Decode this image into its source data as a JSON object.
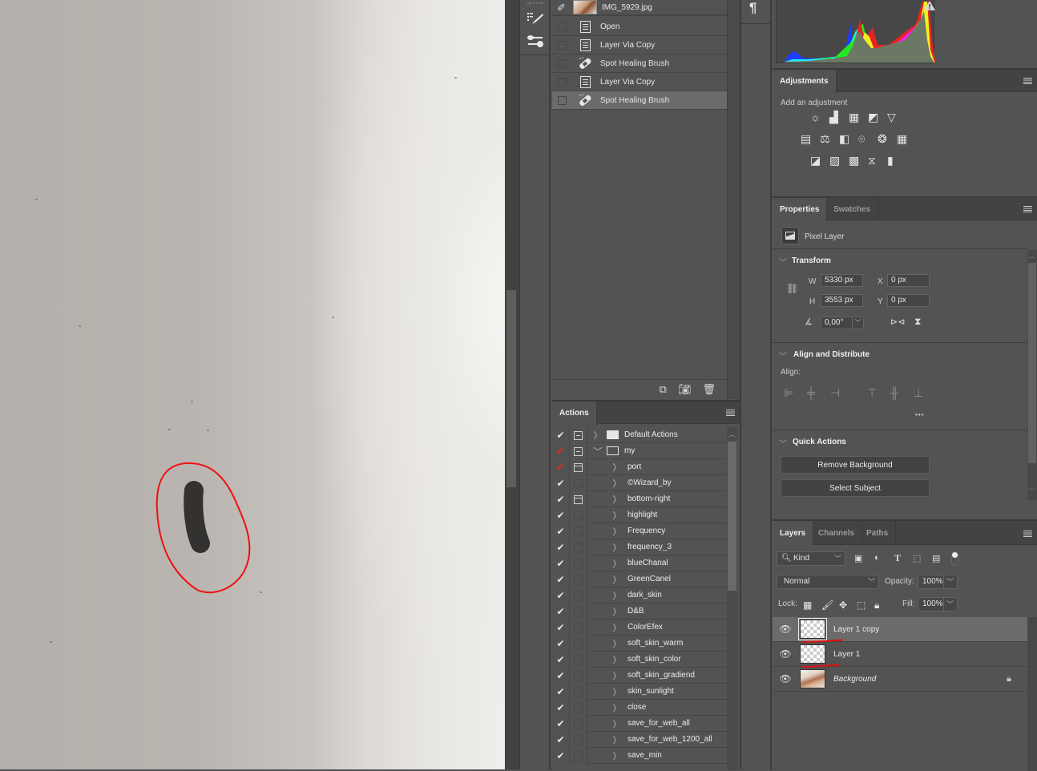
{
  "canvas": {
    "annotation": "red-freehand-circle-around-dark-brush-stroke"
  },
  "toolstrip": {
    "tools": [
      {
        "icon": "brush-presets-icon",
        "label": "Brush presets"
      },
      {
        "icon": "adjust-sliders-icon",
        "label": "Tool presets"
      }
    ]
  },
  "history": {
    "snapshot_label": "IMG_5929.jpg",
    "items": [
      {
        "label": "Open",
        "icon": "document-icon",
        "selected": false
      },
      {
        "label": "Layer Via Copy",
        "icon": "document-icon",
        "selected": false
      },
      {
        "label": "Spot Healing Brush",
        "icon": "bandage-icon",
        "selected": false
      },
      {
        "label": "Layer Via Copy",
        "icon": "document-icon",
        "selected": false
      },
      {
        "label": "Spot Healing Brush",
        "icon": "bandage-icon",
        "selected": true
      }
    ],
    "footer_buttons": [
      "new-document-from-state-icon",
      "camera-snapshot-icon",
      "trash-icon"
    ]
  },
  "actions": {
    "tab_label": "Actions",
    "items": [
      {
        "name": "Default Actions",
        "check": "white",
        "dialog": "minus",
        "type": "set",
        "expanded": false
      },
      {
        "name": "my",
        "check": "red",
        "dialog": "minus",
        "type": "set",
        "expanded": true
      },
      {
        "name": "port",
        "check": "red",
        "dialog": "box",
        "type": "action"
      },
      {
        "name": "©Wizard_by",
        "check": "white",
        "dialog": "none",
        "type": "action"
      },
      {
        "name": "bottom-right",
        "check": "white",
        "dialog": "box",
        "type": "action"
      },
      {
        "name": "highlight",
        "check": "white",
        "dialog": "none",
        "type": "action"
      },
      {
        "name": "Frequency",
        "check": "white",
        "dialog": "none",
        "type": "action"
      },
      {
        "name": "frequency_3",
        "check": "white",
        "dialog": "none",
        "type": "action"
      },
      {
        "name": "blueChanal",
        "check": "white",
        "dialog": "none",
        "type": "action"
      },
      {
        "name": "GreenCanel",
        "check": "white",
        "dialog": "none",
        "type": "action"
      },
      {
        "name": "dark_skin",
        "check": "white",
        "dialog": "none",
        "type": "action"
      },
      {
        "name": "D&B",
        "check": "white",
        "dialog": "none",
        "type": "action"
      },
      {
        "name": "ColorEfex",
        "check": "white",
        "dialog": "none",
        "type": "action"
      },
      {
        "name": "soft_skin_warm",
        "check": "white",
        "dialog": "none",
        "type": "action"
      },
      {
        "name": "soft_skin_color",
        "check": "white",
        "dialog": "none",
        "type": "action"
      },
      {
        "name": "soft_skin_gradiend",
        "check": "white",
        "dialog": "none",
        "type": "action"
      },
      {
        "name": "skin_sunlight",
        "check": "white",
        "dialog": "none",
        "type": "action"
      },
      {
        "name": "close",
        "check": "white",
        "dialog": "none",
        "type": "action"
      },
      {
        "name": "save_for_web_all",
        "check": "white",
        "dialog": "none",
        "type": "action"
      },
      {
        "name": "save_for_web_1200_all",
        "check": "white",
        "dialog": "none",
        "type": "action"
      },
      {
        "name": "save_min",
        "check": "white",
        "dialog": "none",
        "type": "action"
      }
    ]
  },
  "parastrip": {
    "icon": "paragraph-icon",
    "glyph": "¶"
  },
  "histogram": {
    "warning_icon": "cached-data-warning-icon",
    "colors": {
      "blue": "#1f3cff",
      "cyan": "#22f0f0",
      "green": "#22e822",
      "red": "#e82222",
      "yellow": "#f0f020",
      "magenta": "#f020f0",
      "gray": "#6b7866"
    }
  },
  "adjustments": {
    "tab_label": "Adjustments",
    "subtitle": "Add an adjustment",
    "rows": [
      [
        "brightness-contrast-icon",
        "levels-icon",
        "curves-icon",
        "exposure-icon",
        "vibrance-icon"
      ],
      [
        "hue-saturation-icon",
        "color-balance-icon",
        "black-white-icon",
        "photo-filter-icon",
        "channel-mixer-icon",
        "color-lookup-icon"
      ],
      [
        "invert-icon",
        "posterize-icon",
        "threshold-icon",
        "selective-color-icon",
        "gradient-map-icon"
      ]
    ]
  },
  "properties": {
    "tabs": [
      "Properties",
      "Swatches"
    ],
    "active_tab": "Properties",
    "layer_kind": "Pixel Layer",
    "transform": {
      "title": "Transform",
      "w_label": "W",
      "w_value": "5330 px",
      "h_label": "H",
      "h_value": "3553 px",
      "x_label": "X",
      "x_value": "0 px",
      "y_label": "Y",
      "y_value": "0 px",
      "angle_value": "0,00°"
    },
    "align": {
      "title": "Align and Distribute",
      "label": "Align:",
      "more": "•••"
    },
    "quick_actions": {
      "title": "Quick Actions",
      "buttons": [
        "Remove Background",
        "Select Subject"
      ]
    }
  },
  "layers": {
    "tabs": [
      "Layers",
      "Channels",
      "Paths"
    ],
    "active_tab": "Layers",
    "filter_kind": "Kind",
    "blend_mode": "Normal",
    "opacity_label": "Opacity:",
    "opacity_value": "100%",
    "lock_label": "Lock:",
    "fill_label": "Fill:",
    "fill_value": "100%",
    "items": [
      {
        "name": "Layer 1 copy",
        "visible": true,
        "selected": true,
        "thumb": "transparent",
        "locked": false
      },
      {
        "name": "Layer 1",
        "visible": true,
        "selected": false,
        "thumb": "transparent",
        "locked": false
      },
      {
        "name": "Background",
        "visible": true,
        "selected": false,
        "thumb": "photo",
        "locked": true
      }
    ]
  }
}
